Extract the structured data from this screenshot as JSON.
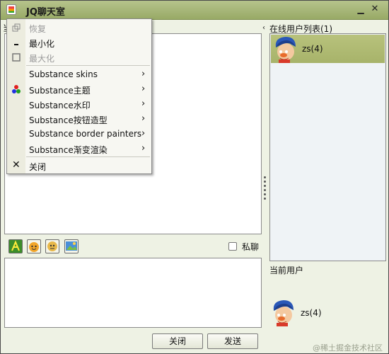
{
  "window": {
    "title": "JQ聊天室",
    "min_glyph": "▁",
    "close_glyph": "✕"
  },
  "menu": {
    "items": [
      {
        "label": "恢复",
        "icon": "restore-icon"
      },
      {
        "label": "最小化",
        "icon": "minimize-icon"
      },
      {
        "label": "最大化",
        "icon": "maximize-icon"
      },
      {
        "label": "Substance skins",
        "sub": "›"
      },
      {
        "label": "Substance主题",
        "sub": "›",
        "icon": "theme-dots-icon"
      },
      {
        "label": "Substance水印",
        "sub": "›"
      },
      {
        "label": "Substance按钮造型",
        "sub": "›"
      },
      {
        "label": "Substance border painters",
        "sub": "›"
      },
      {
        "label": "Substance渐变渲染",
        "sub": "›"
      },
      {
        "label": "关闭",
        "icon": "close-icon",
        "glyph": "✕"
      }
    ]
  },
  "chat": {
    "history_label": "当"
  },
  "online": {
    "header": "在线用户列表(1)",
    "arrow": "‹",
    "users": [
      {
        "name": "zs(4)"
      }
    ]
  },
  "toolbar": {
    "private_label": "私聊"
  },
  "current_user": {
    "header": "当前用户",
    "name": "zs(4)"
  },
  "buttons": {
    "close": "关闭",
    "send": "发送"
  },
  "watermark": "@稀土掘金技术社区",
  "colors": {
    "titlebar": "#a8b878",
    "selected_row": "#adb870",
    "menu_bg": "#f7f7f2"
  }
}
